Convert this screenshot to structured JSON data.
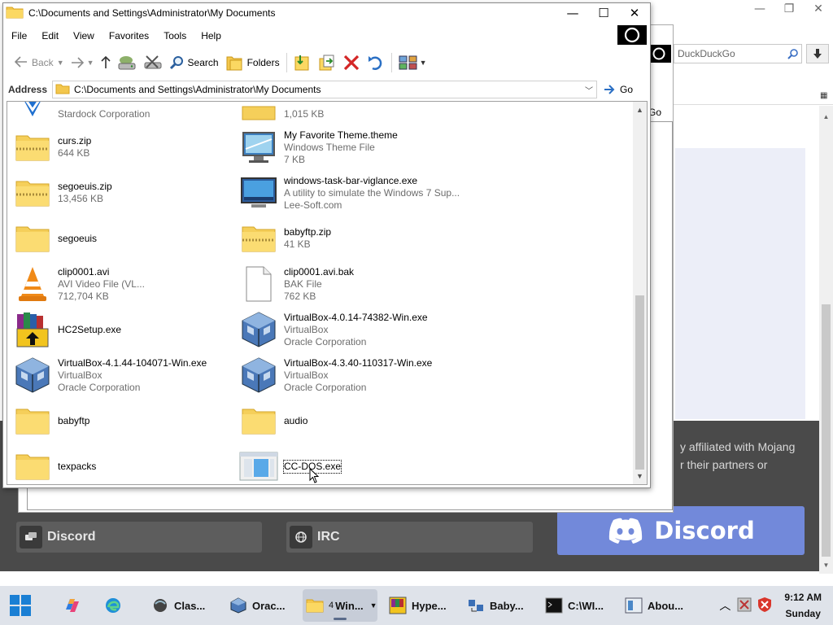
{
  "browser": {
    "search_placeholder": "DuckDuckGo",
    "dark_text_line1": "y affiliated with Mojang",
    "dark_text_line2": "r their partners or",
    "button_discord_grey": "Discord",
    "button_irc": "IRC",
    "button_discord_big": "Discord",
    "colors": {
      "dark_section": "#4a4a4a",
      "discord_blurple": "#7289da"
    }
  },
  "behind_window": {
    "go_label": "Go"
  },
  "explorer": {
    "title": "C:\\Documents and Settings\\Administrator\\My Documents",
    "menu": [
      "File",
      "Edit",
      "View",
      "Favorites",
      "Tools",
      "Help"
    ],
    "toolbar": {
      "back": "Back",
      "search": "Search",
      "folders": "Folders"
    },
    "address": {
      "label": "Address",
      "path": "C:\\Documents and Settings\\Administrator\\My Documents",
      "go": "Go"
    },
    "items_partial": [
      {
        "sub1": "Stardock Corporation",
        "icon": "stardock-shield-icon"
      },
      {
        "sub1": "1,015 KB",
        "icon": "zip-folder-icon"
      }
    ],
    "items": [
      {
        "name": "curs.zip",
        "sub1": "644 KB",
        "sub2": "",
        "icon": "zip-folder-icon"
      },
      {
        "name": "My Favorite Theme.theme",
        "sub1": "Windows Theme File",
        "sub2": "7 KB",
        "icon": "theme-file-icon"
      },
      {
        "name": "segoeuis.zip",
        "sub1": "13,456 KB",
        "sub2": "",
        "icon": "zip-folder-icon"
      },
      {
        "name": "windows-task-bar-viglance.exe",
        "sub1": "A utility to simulate the Windows 7 Sup...",
        "sub2": "Lee-Soft.com",
        "icon": "monitor-app-icon"
      },
      {
        "name": "segoeuis",
        "sub1": "",
        "sub2": "",
        "icon": "folder-icon"
      },
      {
        "name": "babyftp.zip",
        "sub1": "41 KB",
        "sub2": "",
        "icon": "zip-folder-icon"
      },
      {
        "name": "clip0001.avi",
        "sub1": "AVI Video File (VL...",
        "sub2": "712,704 KB",
        "icon": "vlc-cone-icon"
      },
      {
        "name": "clip0001.avi.bak",
        "sub1": "BAK File",
        "sub2": "762 KB",
        "icon": "blank-file-icon"
      },
      {
        "name": "HC2Setup.exe",
        "sub1": "",
        "sub2": "",
        "icon": "installer-books-icon"
      },
      {
        "name": "VirtualBox-4.0.14-74382-Win.exe",
        "sub1": "VirtualBox",
        "sub2": "Oracle Corporation",
        "icon": "virtualbox-icon"
      },
      {
        "name": "VirtualBox-4.1.44-104071-Win.exe",
        "sub1": "VirtualBox",
        "sub2": "Oracle Corporation",
        "icon": "virtualbox-icon"
      },
      {
        "name": "VirtualBox-4.3.40-110317-Win.exe",
        "sub1": "VirtualBox",
        "sub2": "Oracle Corporation",
        "icon": "virtualbox-icon"
      },
      {
        "name": "babyftp",
        "sub1": "",
        "sub2": "",
        "icon": "folder-icon"
      },
      {
        "name": "audio",
        "sub1": "",
        "sub2": "",
        "icon": "folder-icon"
      },
      {
        "name": "texpacks",
        "sub1": "",
        "sub2": "",
        "icon": "folder-icon"
      },
      {
        "name": "CC-DOS.exe",
        "sub1": "",
        "sub2": "",
        "icon": "exe-window-icon",
        "selected": true
      }
    ]
  },
  "taskbar": {
    "buttons": [
      {
        "label": "Clas...",
        "icon": "classic-shell-icon"
      },
      {
        "label": "Orac...",
        "icon": "virtualbox-icon"
      },
      {
        "label": "Win...",
        "count": "4",
        "icon": "folder-icon",
        "active": true
      },
      {
        "label": "Hype...",
        "icon": "hyper-icon"
      },
      {
        "label": "Baby...",
        "icon": "babyftp-icon"
      },
      {
        "label": "C:\\WI...",
        "icon": "cmd-icon"
      },
      {
        "label": "Abou...",
        "icon": "about-window-icon"
      }
    ],
    "clock_time": "9:12 AM",
    "clock_day": "Sunday"
  }
}
